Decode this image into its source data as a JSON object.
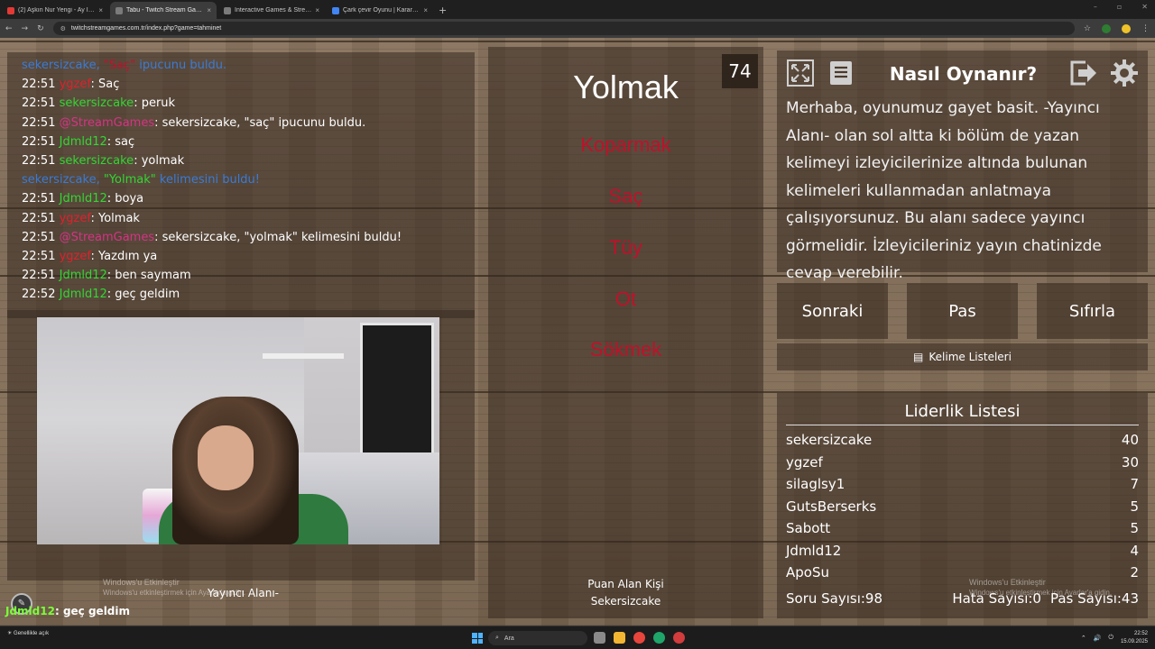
{
  "browser": {
    "tabs": [
      {
        "title": "(2) Aşkın Nur Yengi - Ay İnan...",
        "color": "#e53935",
        "active": false
      },
      {
        "title": "Tabu - Twitch Stream Games",
        "color": "#7b7b7b",
        "active": true
      },
      {
        "title": "Interactive Games & Streaming...",
        "color": "#7b7b7b",
        "active": false
      },
      {
        "title": "Çark çevir Oyunu | Karar Çarkı",
        "color": "#4285f4",
        "active": false
      }
    ],
    "url": "twitchstreamgames.com.tr/index.php?game=tahminet",
    "new_tab_glyph": "+",
    "tab_close_glyph": "×",
    "window_controls": [
      "–",
      "▫",
      "✕"
    ],
    "nav_glyphs": [
      "←",
      "→",
      "↻"
    ],
    "bookmark_glyph": "☆",
    "menu_glyph": "⋮"
  },
  "chat": {
    "messages": [
      {
        "type": "system",
        "time": "",
        "parts": [
          {
            "text": "sekersizcake, ",
            "color": "#3a7bd5"
          },
          {
            "text": "\"Saç\"",
            "color": "#c0112a"
          },
          {
            "text": " ipucunu buldu.",
            "color": "#3a7bd5"
          }
        ]
      },
      {
        "type": "user",
        "time": "22:51",
        "user": "ygzef",
        "ucolor": "#e0202c",
        "text": ": Saç"
      },
      {
        "type": "user",
        "time": "22:51",
        "user": "sekersizcake",
        "ucolor": "#33d633",
        "text": ": peruk"
      },
      {
        "type": "user",
        "time": "22:51",
        "user": "@StreamGames",
        "ucolor": "#d63384",
        "text": ": sekersizcake, \"saç\" ipucunu buldu."
      },
      {
        "type": "user",
        "time": "22:51",
        "user": "Jdmld12",
        "ucolor": "#33d633",
        "text": ": saç"
      },
      {
        "type": "user",
        "time": "22:51",
        "user": "sekersizcake",
        "ucolor": "#33d633",
        "text": ": yolmak"
      },
      {
        "type": "system",
        "time": "",
        "parts": [
          {
            "text": "sekersizcake, ",
            "color": "#3a7bd5"
          },
          {
            "text": "\"Yolmak\"",
            "color": "#33d633"
          },
          {
            "text": " kelimesini buldu!",
            "color": "#3a7bd5"
          }
        ]
      },
      {
        "type": "user",
        "time": "22:51",
        "user": "Jdmld12",
        "ucolor": "#33d633",
        "text": ": boya"
      },
      {
        "type": "user",
        "time": "22:51",
        "user": "ygzef",
        "ucolor": "#e0202c",
        "text": ": Yolmak"
      },
      {
        "type": "user",
        "time": "22:51",
        "user": "@StreamGames",
        "ucolor": "#d63384",
        "text": ": sekersizcake, \"yolmak\" kelimesini buldu!"
      },
      {
        "type": "user",
        "time": "22:51",
        "user": "ygzef",
        "ucolor": "#e0202c",
        "text": ": Yazdım ya"
      },
      {
        "type": "user",
        "time": "22:51",
        "user": "Jdmld12",
        "ucolor": "#33d633",
        "text": ": ben saymam"
      },
      {
        "type": "user",
        "time": "22:52",
        "user": "Jdmld12",
        "ucolor": "#33d633",
        "text": ": geç geldim"
      }
    ]
  },
  "webcam": {
    "caption": "Yayıncı Alanı-",
    "overlay_user": "Jdmld12",
    "overlay_text": ": geç geldim",
    "watermark_title": "Windows'u Etkinleştir",
    "watermark_sub": "Windows'u etkinleştirmek için Ayarlar'a gidin."
  },
  "card": {
    "timer": "74",
    "word": "Yolmak",
    "taboo_words": [
      "Koparmak",
      "Saç",
      "Tüy",
      "Ot",
      "Sökmek"
    ],
    "scorer_label": "Puan Alan Kişi",
    "scorer_name": "Sekersizcake"
  },
  "howto": {
    "title": "Nasıl Oynanır?",
    "text": "Merhaba, oyunumuz gayet basit. -Yayıncı Alanı- olan sol altta ki bölüm de yazan kelimeyi izleyicilerinize altında bulunan kelimeleri kullanmadan anlatmaya çalışıyorsunuz. Bu alanı sadece yayıncı görmelidir. İzleyicileriniz yayın chatinizde cevap verebilir."
  },
  "buttons": {
    "next": "Sonraki",
    "pass": "Pas",
    "reset": "Sıfırla",
    "word_lists": "Kelime Listeleri",
    "word_lists_icon": "▤"
  },
  "leaderboard": {
    "title": "Liderlik Listesi",
    "rows": [
      {
        "name": "sekersizcake",
        "score": "40"
      },
      {
        "name": "ygzef",
        "score": "30"
      },
      {
        "name": "silaglsy1",
        "score": "7"
      },
      {
        "name": "GutsBerserks",
        "score": "5"
      },
      {
        "name": "Sabott",
        "score": "5"
      },
      {
        "name": "Jdmld12",
        "score": "4"
      },
      {
        "name": "ApoSu",
        "score": "2"
      }
    ],
    "questions": "Soru Sayısı:98",
    "errors": "Hata Sayısı:0",
    "passes": "Pas Sayısı:43",
    "watermark_title": "Windows'u Etkinleştir",
    "watermark_sub": "Windows'u etkinleştirmek için Ayarlar'a gidin."
  },
  "taskbar": {
    "weather": "Genellikle açık",
    "search_placeholder": "Ara",
    "time": "22:52",
    "date": "15.09.2025",
    "tray_glyphs": [
      "⌃",
      "🔊",
      "⏻"
    ]
  }
}
